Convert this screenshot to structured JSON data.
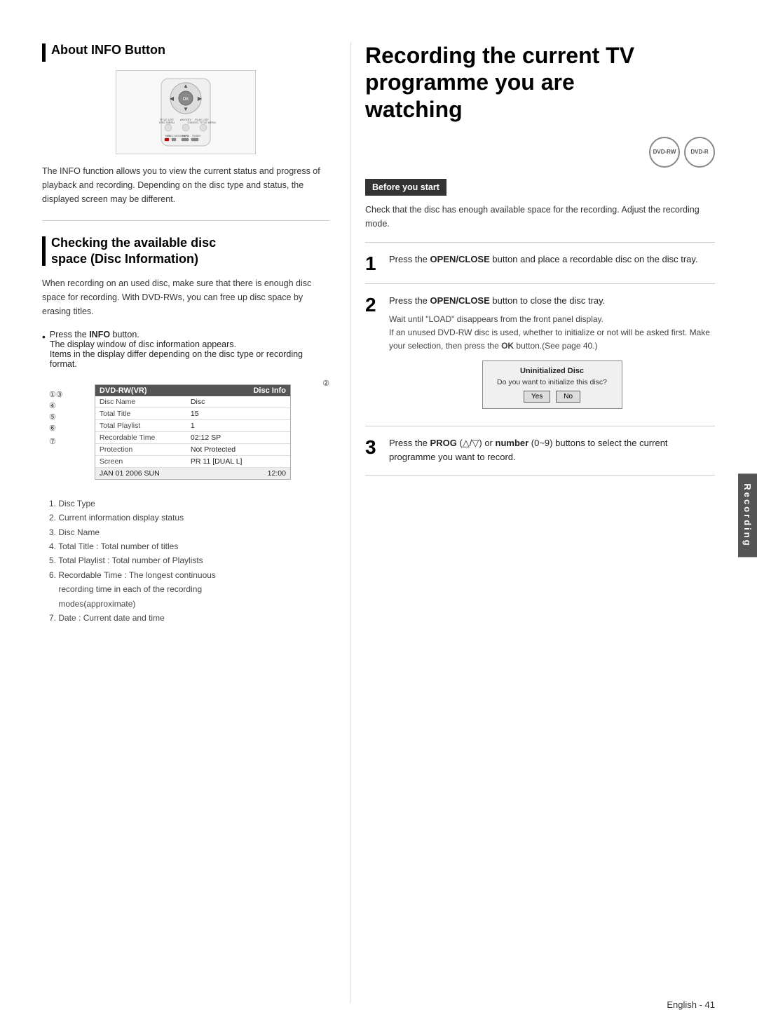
{
  "page": {
    "footer": "English - 41"
  },
  "left": {
    "about_info": {
      "heading": "About INFO Button",
      "body_text": "The INFO function allows you to view the current status and progress of playback and recording. Depending on the disc type and status, the displayed screen may be different."
    },
    "checking_disc": {
      "heading_line1": "Checking the available disc",
      "heading_line2": "space (Disc Information)",
      "body_text": "When recording on an used disc, make sure that there is enough disc space for recording. With DVD-RWs, you can free up disc space by erasing titles.",
      "bullet_text": "Press the",
      "bullet_bold": "INFO",
      "bullet_rest": "button.",
      "display_text": "The display window of disc information appears.",
      "items_text": "Items in the display differ depending on the disc type or recording format.",
      "disc_table": {
        "header_left": "DVD-RW(VR)",
        "header_right": "Disc Info",
        "rows": [
          {
            "label": "Disc Name",
            "value": "Disc"
          },
          {
            "label": "Total Title",
            "value": "15"
          },
          {
            "label": "Total Playlist",
            "value": "1"
          },
          {
            "label": "Recordable Time",
            "value": "02:12 SP"
          },
          {
            "label": "Protection",
            "value": "Not Protected"
          },
          {
            "label": "Screen",
            "value": "PR 11 [DUAL L]"
          }
        ],
        "footer_left": "JAN 01 2006 SUN",
        "footer_right": "12:00"
      },
      "annotations_left": [
        "①",
        "③",
        "④",
        "⑤",
        "⑥",
        "⑦"
      ],
      "annotation_right": "②",
      "numbered_list": [
        "1. Disc Type",
        "2. Current information display status",
        "3. Disc Name",
        "4. Total Title : Total number of titles",
        "5. Total Playlist : Total number of Playlists",
        "6. Recordable Time : The longest continuous recording time in each of the recording modes(approximate)",
        "7. Date : Current date and time"
      ]
    }
  },
  "right": {
    "title_line1": "Recording the current TV",
    "title_line2": "programme you are",
    "title_line3": "watching",
    "disc_labels": [
      "DVD-RW",
      "DVD-R"
    ],
    "before_you_start": "Before you start",
    "before_text": "Check that the disc has enough available space for the recording. Adjust the recording mode.",
    "steps": [
      {
        "number": "1",
        "main": "Press the OPEN/CLOSE button and place a recordable disc on the disc tray.",
        "sub": ""
      },
      {
        "number": "2",
        "main": "Press the OPEN/CLOSE button to close the disc tray.",
        "sub": "Wait until \"LOAD\" disappears from the front panel display.\nIf an unused DVD-RW disc is used, whether to initialize or not will be asked first. Make your selection, then press the OK button.(See page 40.)"
      },
      {
        "number": "3",
        "main": "Press the PROG (▲/▼) or number (0~9) buttons to select the current programme you want to record.",
        "sub": ""
      }
    ],
    "dialog": {
      "title": "Uninitialized Disc",
      "text": "Do you want to initialize this disc?",
      "yes": "Yes",
      "no": "No"
    },
    "side_tab": "Recording"
  }
}
